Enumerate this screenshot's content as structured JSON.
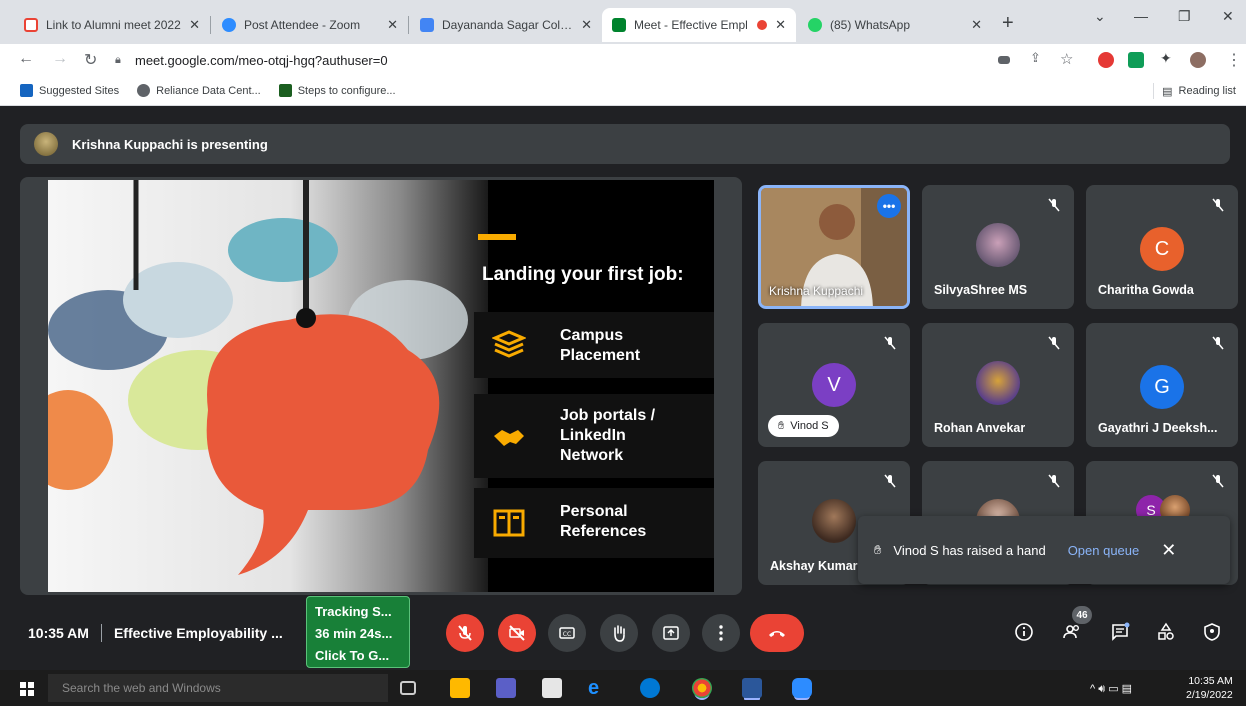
{
  "browser": {
    "tabs": [
      {
        "title": "Link to Alumni meet 2022",
        "color": "#ea4335"
      },
      {
        "title": "Post Attendee - Zoom",
        "color": "#2d8cff"
      },
      {
        "title": "Dayananda Sagar College",
        "color": "#4285f4"
      },
      {
        "title": "Meet - Effective Empl",
        "color": "#00832d",
        "active": true
      },
      {
        "title": "(85) WhatsApp",
        "color": "#25d366"
      }
    ],
    "tab_close": "✕",
    "new_tab": "+",
    "url": "meet.google.com/meo-otqj-hgq?authuser=0",
    "bookmarks": [
      "Suggested Sites",
      "Reliance Data Cent...",
      "Steps to configure..."
    ],
    "reading_list": "Reading list"
  },
  "meet": {
    "presenter_banner": "Krishna Kuppachi is presenting",
    "slide": {
      "title": "Landing your first job:",
      "items": [
        {
          "text": "Campus\nPlacement",
          "icon": "stack-icon"
        },
        {
          "text": "Job portals /\nLinkedIn\nNetwork",
          "icon": "handshake-icon"
        },
        {
          "text": "Personal\nReferences",
          "icon": "book-icon"
        }
      ],
      "accent": "#f9ab00"
    },
    "participants": [
      {
        "name": "Krishna Kuppachi",
        "type": "video",
        "speaker": true
      },
      {
        "name": "SilvyaShree MS",
        "type": "photo",
        "muted": true
      },
      {
        "name": "Charitha Gowda",
        "type": "initial",
        "initial": "C",
        "color": "#e8612c",
        "muted": true
      },
      {
        "name": "Vinod S",
        "type": "initial",
        "initial": "V",
        "color": "#7b3fc4",
        "muted": true,
        "hand_raised": true
      },
      {
        "name": "Rohan Anvekar",
        "type": "photo",
        "muted": true
      },
      {
        "name": "Gayathri J Deeksh...",
        "type": "initial",
        "initial": "G",
        "color": "#1a73e8",
        "muted": true
      },
      {
        "name": "Akshay Kumar",
        "type": "photo",
        "muted": true
      },
      {
        "name": "",
        "type": "photo",
        "muted": true
      },
      {
        "name": "",
        "type": "initial",
        "initial": "S",
        "color": "#8e24aa",
        "muted": true
      }
    ],
    "toast": {
      "message": "Vinod S has raised a hand",
      "action": "Open queue"
    },
    "time": "10:35 AM",
    "meeting_name": "Effective Employability ...",
    "tracking": [
      "Tracking S...",
      "36 min 24s...",
      "Click To G..."
    ],
    "participant_count": "46"
  },
  "taskbar": {
    "search_placeholder": "Search the web and Windows",
    "time": "10:35 AM",
    "date": "2/19/2022"
  }
}
